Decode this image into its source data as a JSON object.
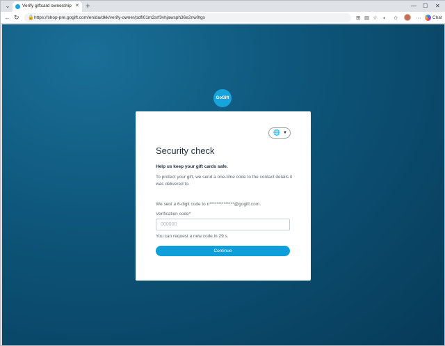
{
  "browser": {
    "tab_title": "Verify giftcard ownership",
    "url": "https://shop-pre.gogift.com/en/da/dkk/verify-owner/pdf/01m2srf3vhjawsph36e2nw0tgs",
    "chat_label": "Chat",
    "accent": "#1aa6e0"
  },
  "brand": {
    "logo_text": "GoGift",
    "color": "#17a3dc"
  },
  "card": {
    "language_icon": "globe-icon",
    "title": "Security check",
    "subtitle": "Help us keep your gift cards safe.",
    "description": "To protect your gift, we send a one-time code to the contact details it was delivered to.",
    "sent_message": "We sent a 6-digit code to n**************@gogift.com.",
    "field_label": "Verification code*",
    "field_placeholder": "000000",
    "field_value": "",
    "resend_message": "You can request a new code in 29 s.",
    "continue_label": "Continue"
  }
}
